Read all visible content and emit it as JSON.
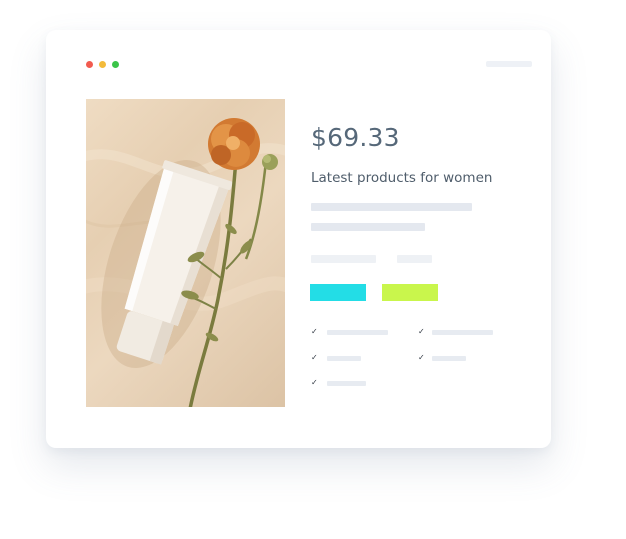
{
  "window": {
    "controls": [
      {
        "name": "close",
        "color": "#f25b4f"
      },
      {
        "name": "minimize",
        "color": "#f3bb3b"
      },
      {
        "name": "maximize",
        "color": "#3bc449"
      }
    ]
  },
  "product": {
    "price": "$69.33",
    "subtitle": "Latest products for women",
    "image_icon": "cream-tube-with-dried-flower",
    "buttons": [
      {
        "name": "primary",
        "color": "#23dde6"
      },
      {
        "name": "secondary",
        "color": "#c9f64c"
      }
    ],
    "features": [
      {
        "icon": "check-icon"
      },
      {
        "icon": "check-icon"
      },
      {
        "icon": "check-icon"
      },
      {
        "icon": "check-icon"
      },
      {
        "icon": "check-icon"
      }
    ]
  }
}
